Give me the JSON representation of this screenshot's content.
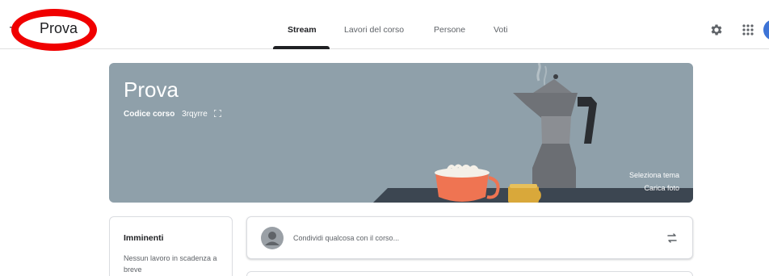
{
  "header": {
    "course_name": "Prova",
    "tabs": [
      {
        "label": "Stream",
        "active": true
      },
      {
        "label": "Lavori del corso",
        "active": false
      },
      {
        "label": "Persone",
        "active": false
      },
      {
        "label": "Voti",
        "active": false
      }
    ],
    "icons": [
      "menu-icon",
      "gear-icon",
      "apps-icon",
      "avatar"
    ]
  },
  "banner": {
    "title": "Prova",
    "code_label": "Codice corso",
    "code_value": "3rqyrre",
    "select_theme": "Seleziona tema",
    "upload_photo": "Carica foto",
    "background_color": "#8fa0aa"
  },
  "upcoming": {
    "title": "Imminenti",
    "text": "Nessun lavoro in scadenza a breve"
  },
  "share": {
    "placeholder": "Condividi qualcosa con il corso..."
  },
  "colors": {
    "accent": "#202124",
    "annotation": "#f00000",
    "avatar": "#3e74d6"
  }
}
